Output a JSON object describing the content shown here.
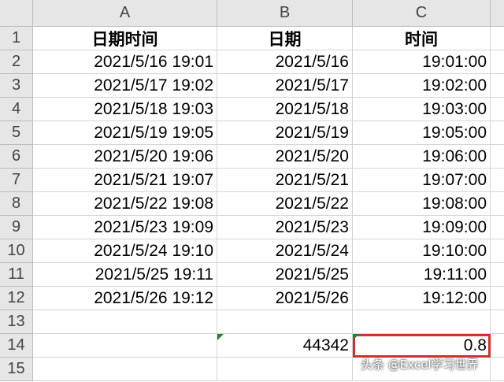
{
  "columns": [
    "A",
    "B",
    "C"
  ],
  "rows": [
    {
      "num": "1",
      "a": "日期时间",
      "b": "日期",
      "c": "时间"
    },
    {
      "num": "2",
      "a": "2021/5/16 19:01",
      "b": "2021/5/16",
      "c": "19:01:00"
    },
    {
      "num": "3",
      "a": "2021/5/17 19:02",
      "b": "2021/5/17",
      "c": "19:02:00"
    },
    {
      "num": "4",
      "a": "2021/5/18 19:03",
      "b": "2021/5/18",
      "c": "19:03:00"
    },
    {
      "num": "5",
      "a": "2021/5/19 19:05",
      "b": "2021/5/19",
      "c": "19:05:00"
    },
    {
      "num": "6",
      "a": "2021/5/20 19:06",
      "b": "2021/5/20",
      "c": "19:06:00"
    },
    {
      "num": "7",
      "a": "2021/5/21 19:07",
      "b": "2021/5/21",
      "c": "19:07:00"
    },
    {
      "num": "8",
      "a": "2021/5/22 19:08",
      "b": "2021/5/22",
      "c": "19:08:00"
    },
    {
      "num": "9",
      "a": "2021/5/23 19:09",
      "b": "2021/5/23",
      "c": "19:09:00"
    },
    {
      "num": "10",
      "a": "2021/5/24 19:10",
      "b": "2021/5/24",
      "c": "19:10:00"
    },
    {
      "num": "11",
      "a": "2021/5/25 19:11",
      "b": "2021/5/25",
      "c": "19:11:00"
    },
    {
      "num": "12",
      "a": "2021/5/26 19:12",
      "b": "2021/5/26",
      "c": "19:12:00"
    },
    {
      "num": "13",
      "a": "",
      "b": "",
      "c": ""
    },
    {
      "num": "14",
      "a": "",
      "b": "44342",
      "c": "0.8"
    },
    {
      "num": "15",
      "a": "",
      "b": "",
      "c": ""
    }
  ],
  "watermark": "头条 @Excel学习世界",
  "colors": {
    "header_bg": "#e6e6e6",
    "selection": "#d32f2f",
    "error_indicator": "#2e7d32"
  }
}
